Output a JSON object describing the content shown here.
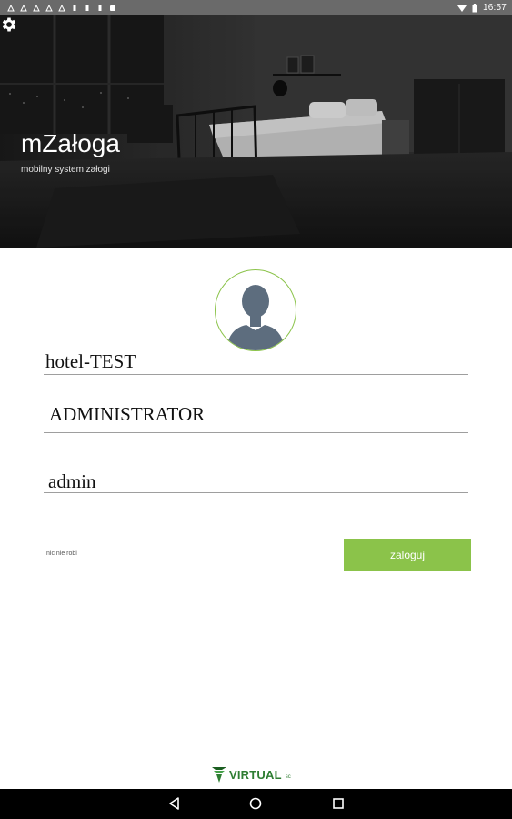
{
  "statusbar": {
    "time": "16:57"
  },
  "header": {
    "title": "mZałoga",
    "subtitle": "mobilny system załogi"
  },
  "form": {
    "hotel": "hotel-TEST",
    "user": "ADMINISTRATOR",
    "password": "admin",
    "forgot_label": "nic nie robi",
    "login_label": "zaloguj"
  },
  "footer": {
    "logo_text": "VIRTUAL",
    "logo_sub": "sc"
  },
  "colors": {
    "accent": "#8bc34a",
    "statusbar": "#6a6a6a",
    "logo": "#2e7d32"
  },
  "icons": [
    "settings-gear-icon",
    "user-avatar-icon",
    "back-icon",
    "home-icon",
    "recents-icon"
  ]
}
